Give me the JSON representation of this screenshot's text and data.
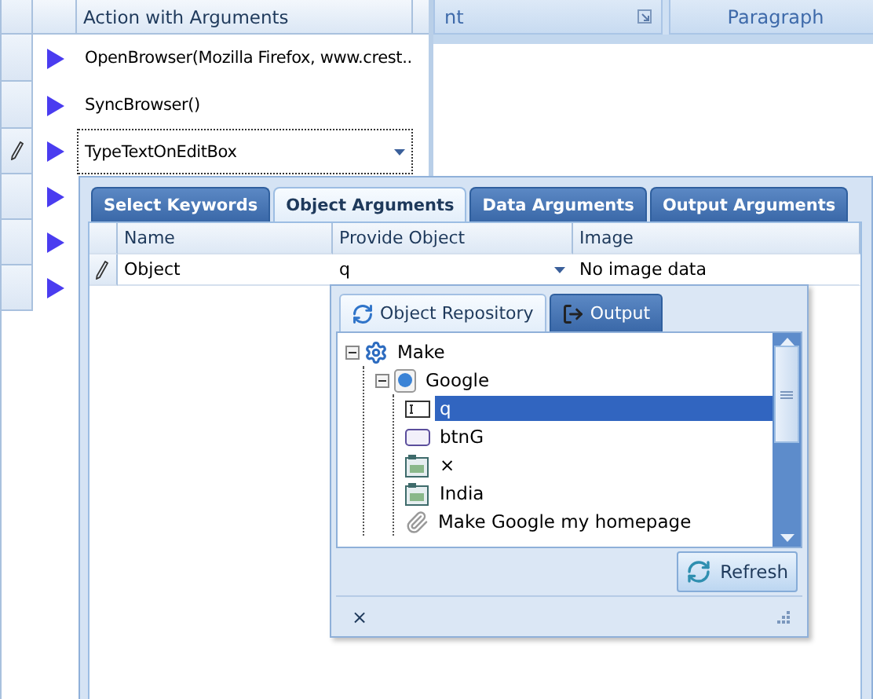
{
  "ribbon": {
    "groups": [
      {
        "label": "nt",
        "launcher": true
      },
      {
        "label": "Paragraph",
        "launcher": false
      }
    ]
  },
  "steps_grid": {
    "column": "Action with Arguments",
    "rows": [
      {
        "action": "OpenBrowser(Mozilla Firefox, www.crest..",
        "editing": false
      },
      {
        "action": "SyncBrowser()",
        "editing": false
      },
      {
        "action": "TypeTextOnEditBox",
        "editing": true
      },
      {
        "editing": false
      },
      {
        "editing": false
      },
      {
        "editing": false
      }
    ]
  },
  "argument_editor": {
    "tabs": [
      {
        "label": "Select Keywords",
        "selected": false
      },
      {
        "label": "Object Arguments",
        "selected": true
      },
      {
        "label": "Data Arguments",
        "selected": false
      },
      {
        "label": "Output Arguments",
        "selected": false
      }
    ],
    "columns": [
      "Name",
      "Provide Object",
      "Image"
    ],
    "rows": [
      {
        "name": "Object",
        "object": "q",
        "image": "No image data",
        "editing": true
      }
    ]
  },
  "object_picker": {
    "tabs": [
      {
        "label": "Object Repository",
        "kind": "repository",
        "selected": true
      },
      {
        "label": "Output",
        "kind": "output",
        "selected": false
      }
    ],
    "tree": [
      {
        "label": "Make",
        "kind": "project",
        "expanded": true,
        "selected": false,
        "children": [
          {
            "label": "Google",
            "kind": "page",
            "expanded": true,
            "selected": false,
            "children": [
              {
                "label": "q",
                "kind": "textbox",
                "selected": true
              },
              {
                "label": "btnG",
                "kind": "button",
                "selected": false
              },
              {
                "label": "×",
                "kind": "frame",
                "selected": false
              },
              {
                "label": "India",
                "kind": "frame",
                "selected": false
              },
              {
                "label": "Make Google my homepage",
                "kind": "link",
                "selected": false
              }
            ]
          }
        ]
      }
    ],
    "refresh_button": "Refresh",
    "footer": "×"
  }
}
